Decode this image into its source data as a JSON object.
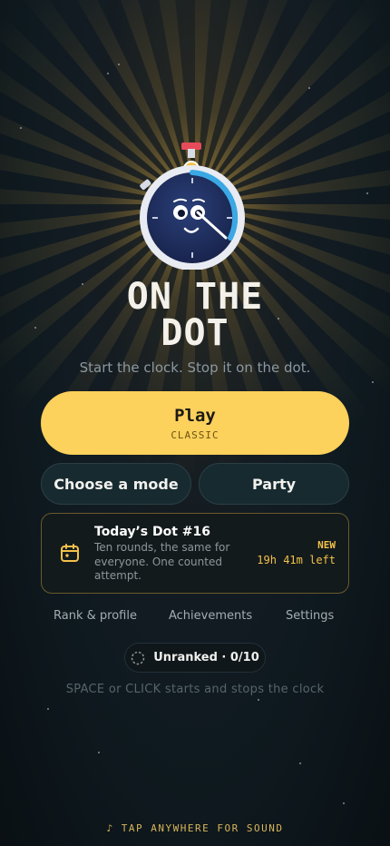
{
  "colors": {
    "accent": "#fcd15c",
    "gold_text": "#f2c14a",
    "background": "#0f1a20",
    "card_border": "#6b5a2c",
    "clock_ring": "#3ba8e4"
  },
  "hero": {
    "mascot_icon": "stopwatch-face-icon",
    "title_line1": "ON THE",
    "title_line2": "DOT",
    "subtitle": "Start the clock. Stop it on the dot."
  },
  "play": {
    "label": "Play",
    "mode": "CLASSIC"
  },
  "secondary": {
    "choose_mode": "Choose a mode",
    "party": "Party"
  },
  "daily": {
    "icon": "calendar-icon",
    "title": "Today’s Dot #16",
    "description": "Ten rounds, the same for everyone. One counted attempt.",
    "badge": "NEW",
    "time_left": "19h 41m left"
  },
  "nav": {
    "rank": "Rank & profile",
    "achievements": "Achievements",
    "settings": "Settings"
  },
  "rank": {
    "icon": "dashed-circle-icon",
    "label": "Unranked · 0/10"
  },
  "hint": "SPACE or CLICK starts and stops the clock",
  "sound": "♪ TAP ANYWHERE FOR SOUND"
}
